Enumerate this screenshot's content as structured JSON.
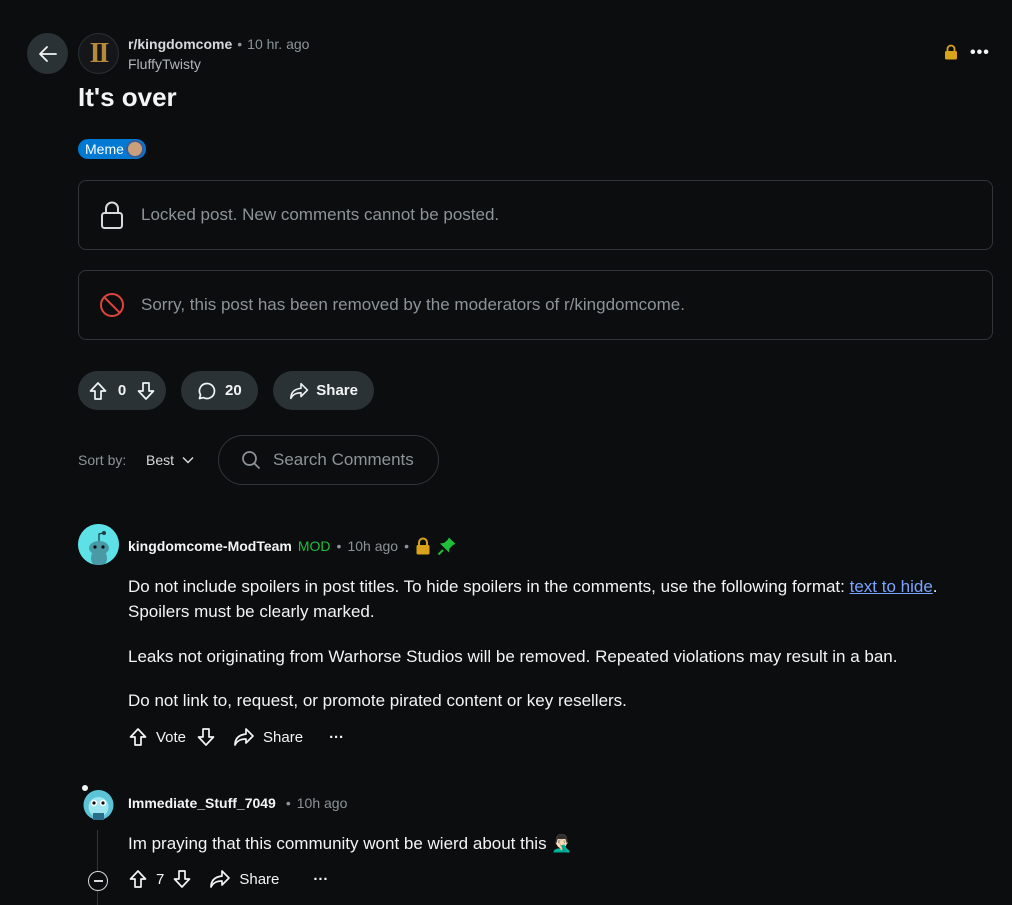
{
  "post": {
    "subreddit": "r/kingdomcome",
    "time": "10 hr. ago",
    "author": "FluffyTwisty",
    "title": "It's over",
    "flair": "Meme",
    "locked_notice": "Locked post. New comments cannot be posted.",
    "removed_notice": "Sorry, this post has been removed by the moderators of r/kingdomcome.",
    "score": "0",
    "comments_count": "20",
    "share_label": "Share"
  },
  "sort": {
    "label": "Sort by:",
    "value": "Best",
    "search_placeholder": "Search Comments"
  },
  "comments": [
    {
      "user": "kingdomcome-ModTeam",
      "badge": "MOD",
      "time": "10h ago",
      "p1_before": "Do not include spoilers in post titles. To hide spoilers in the comments, use the following format: ",
      "p1_link": "text to hide",
      "p1_after": ". Spoilers must be clearly marked.",
      "p2": "Leaks not originating from Warhorse Studios will be removed. Repeated violations may result in a ban.",
      "p3": "Do not link to, request, or promote pirated content or key resellers.",
      "vote_label": "Vote",
      "share_label": "Share",
      "more_label": "···"
    },
    {
      "user": "Immediate_Stuff_7049",
      "time": "10h ago",
      "text": "Im praying that this community wont be wierd about this",
      "emoji": "🤦🏻‍♂️",
      "score": "7",
      "share_label": "Share",
      "more_label": "···"
    }
  ],
  "ui": {
    "dot": "•",
    "top_more": "•••"
  },
  "colors": {
    "background": "#0b0d0e",
    "pill": "#2a3236",
    "flair": "#0079d3",
    "mod": "#1fbf3a",
    "link": "#7aa4ff",
    "lock": "#d8a31a",
    "removed_icon": "#e0443a"
  },
  "icons": [
    "back-arrow-icon",
    "lock-icon",
    "more-icon",
    "ban-icon",
    "upvote-icon",
    "downvote-icon",
    "comment-icon",
    "share-icon",
    "chevron-down-icon",
    "search-icon",
    "pin-icon",
    "collapse-icon"
  ]
}
